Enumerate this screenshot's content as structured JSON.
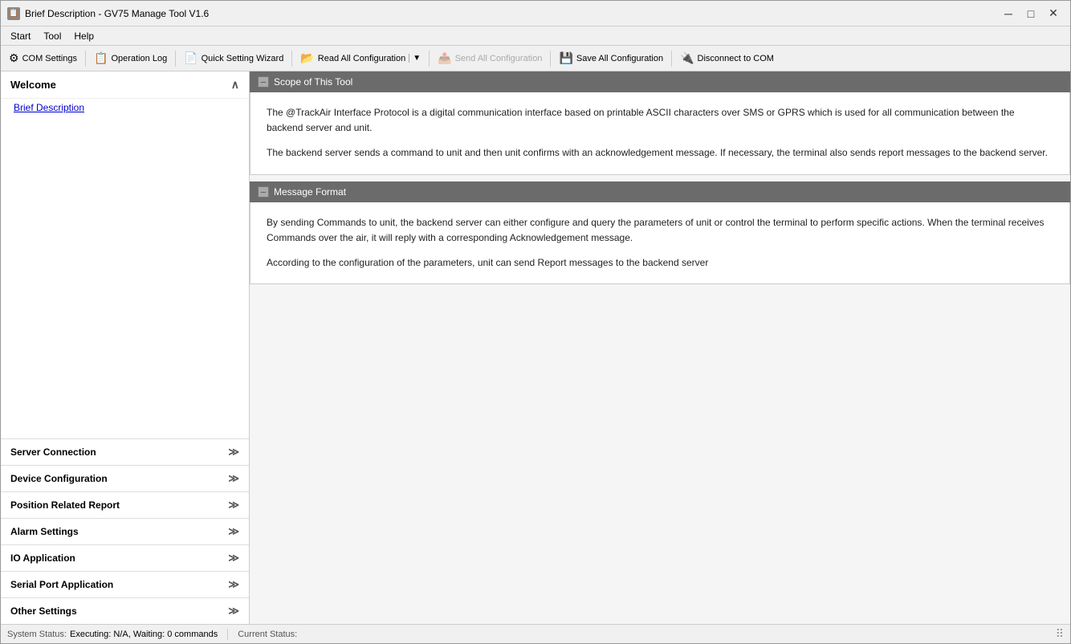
{
  "window": {
    "title": "Brief Description - GV75 Manage Tool V1.6",
    "icon": "📋"
  },
  "titlebar": {
    "minimize": "─",
    "maximize": "□",
    "close": "✕"
  },
  "menu": {
    "items": [
      "Start",
      "Tool",
      "Help"
    ]
  },
  "toolbar": {
    "buttons": [
      {
        "id": "com-settings",
        "label": "COM Settings",
        "icon": "⚙",
        "disabled": false
      },
      {
        "id": "operation-log",
        "label": "Operation Log",
        "icon": "📋",
        "disabled": false
      },
      {
        "id": "quick-setting",
        "label": "Quick Setting Wizard",
        "icon": "📄",
        "disabled": false
      },
      {
        "id": "read-all",
        "label": "Read All Configuration",
        "icon": "📂",
        "disabled": false,
        "dropdown": true
      },
      {
        "id": "send-all",
        "label": "Send All Configuration",
        "icon": "📤",
        "disabled": true
      },
      {
        "id": "save-all",
        "label": "Save All Configuration",
        "icon": "💾",
        "disabled": false
      },
      {
        "id": "disconnect",
        "label": "Disconnect to COM",
        "icon": "🔌",
        "disabled": false
      }
    ]
  },
  "sidebar": {
    "welcome_label": "Welcome",
    "welcome_collapse": "∧",
    "brief_description_link": "Brief Description",
    "sections": [
      {
        "id": "server-connection",
        "label": "Server Connection",
        "icon": "≫"
      },
      {
        "id": "device-config",
        "label": "Device Configuration",
        "icon": "≫"
      },
      {
        "id": "position-report",
        "label": "Position Related Report",
        "icon": "≫"
      },
      {
        "id": "alarm-settings",
        "label": "Alarm Settings",
        "icon": "≫"
      },
      {
        "id": "io-application",
        "label": "IO Application",
        "icon": "≫"
      },
      {
        "id": "serial-port",
        "label": "Serial Port Application",
        "icon": "≫"
      },
      {
        "id": "other-settings",
        "label": "Other Settings",
        "icon": "≫"
      }
    ]
  },
  "content": {
    "sections": [
      {
        "id": "scope",
        "title": "Scope of This Tool",
        "collapse_icon": "─",
        "paragraphs": [
          "The @TrackAir Interface Protocol is a digital communication interface based on printable ASCII characters over SMS or GPRS which is used for all communication between the backend server and unit.",
          "The backend server sends a command to unit and then unit confirms with an acknowledgement message. If necessary, the terminal also sends report messages to the backend server."
        ]
      },
      {
        "id": "message-format",
        "title": "Message Format",
        "collapse_icon": "─",
        "paragraphs": [
          "By sending Commands to unit, the backend server can either configure and query the parameters of unit or control the terminal to perform specific actions. When the terminal receives Commands over the air, it will reply with a corresponding Acknowledgement message.",
          "According to the configuration of the parameters, unit can send Report messages to the backend server"
        ]
      }
    ]
  },
  "statusbar": {
    "system_status_label": "System Status:",
    "system_status_value": "Executing: N/A, Waiting: 0 commands",
    "current_status_label": "Current Status:",
    "current_status_value": ""
  }
}
